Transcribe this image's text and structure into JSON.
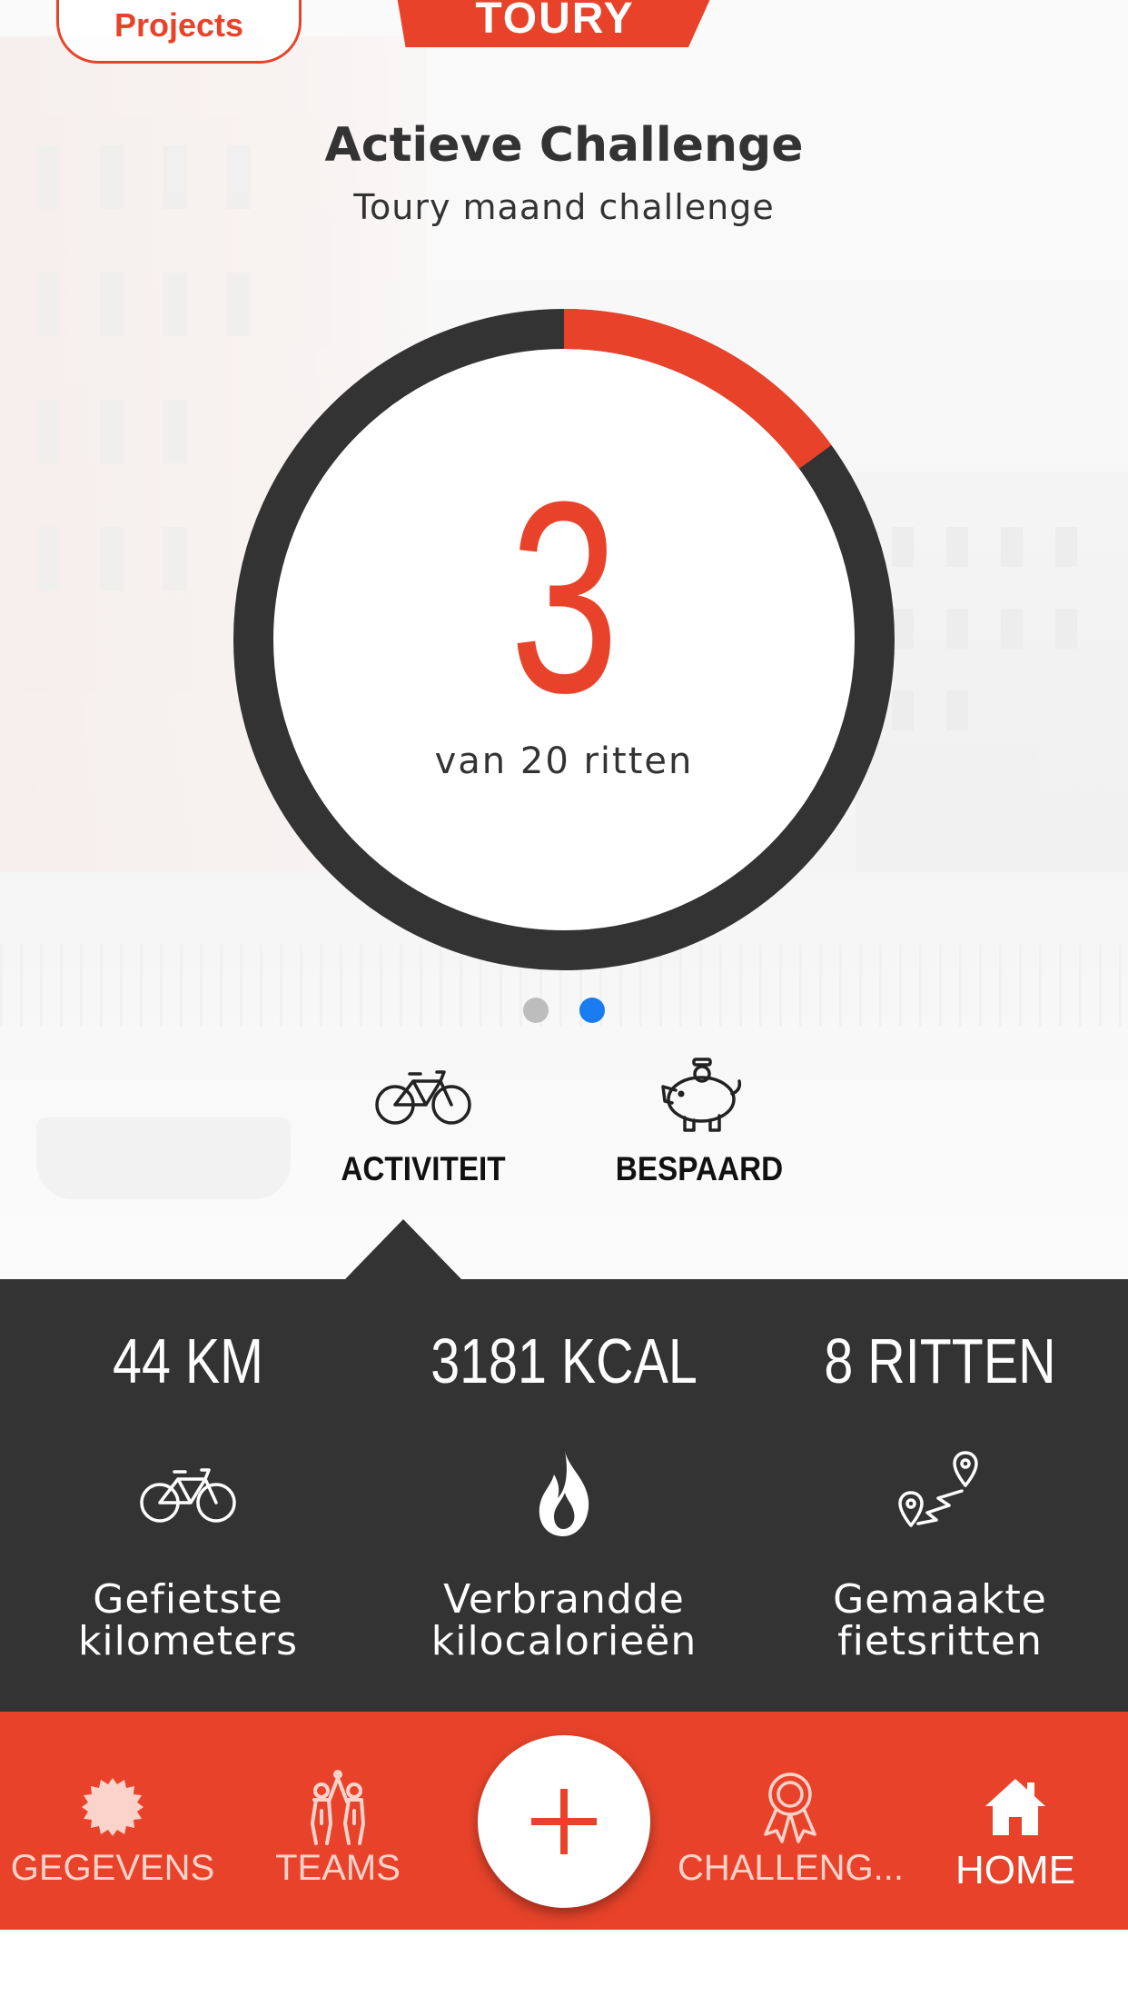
{
  "header": {
    "projects_label": "Projects",
    "logo_text": "TOURY",
    "title": "Actieve Challenge",
    "subtitle": "Toury maand challenge"
  },
  "progress": {
    "current": "3",
    "label": "van 20 ritten",
    "done": 3,
    "total": 20,
    "ring_color": "#333333",
    "progress_color": "#e8432a"
  },
  "pager": {
    "pages": 2,
    "active_index": 1
  },
  "tabs": [
    {
      "label": "ACTIVITEIT",
      "icon": "bicycle-icon",
      "selected": true
    },
    {
      "label": "BESPAARD",
      "icon": "piggy-bank-icon",
      "selected": false
    }
  ],
  "stats": [
    {
      "value": "44 KM",
      "icon": "bicycle-icon",
      "line1": "Gefietste",
      "line2": "kilometers"
    },
    {
      "value": "3181 KCAL",
      "icon": "flame-icon",
      "line1": "Verbrandde",
      "line2": "kilocalorieën"
    },
    {
      "value": "8 RITTEN",
      "icon": "route-pins-icon",
      "line1": "Gemaakte",
      "line2": "fietsritten"
    }
  ],
  "nav": [
    {
      "label": "GEGEVENS",
      "icon": "badge-icon"
    },
    {
      "label": "TEAMS",
      "icon": "team-icon"
    },
    {
      "label": "CHALLENG...",
      "icon": "ribbon-award-icon"
    },
    {
      "label": "HOME",
      "icon": "home-icon",
      "active": true
    }
  ],
  "fab": {
    "icon": "plus-icon"
  },
  "colors": {
    "accent": "#e8432a",
    "dark": "#333333",
    "pager_active": "#1a7cf0"
  }
}
